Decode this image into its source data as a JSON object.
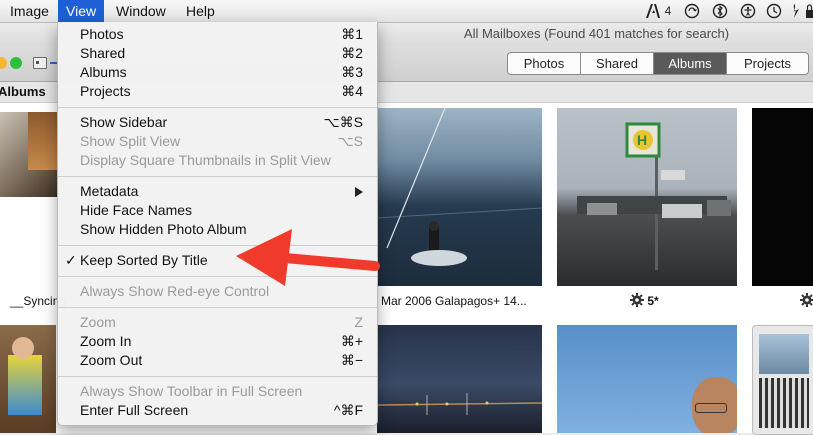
{
  "menubar": {
    "items": [
      "Image",
      "View",
      "Window",
      "Help"
    ],
    "adobe_count": "4"
  },
  "window": {
    "title": "All Mailboxes (Found 401 matches for search)"
  },
  "toolbar": {
    "tabs": [
      "Photos",
      "Shared",
      "Albums",
      "Projects"
    ],
    "active_tab": "Albums"
  },
  "content": {
    "section_label": "Albums",
    "captions": {
      "c1": "__Syncing",
      "c2": "Mar 2006 Galapagos+ 14...",
      "c3": "5*"
    }
  },
  "view_menu": {
    "photos": "Photos",
    "photos_sc": "⌘1",
    "shared": "Shared",
    "shared_sc": "⌘2",
    "albums": "Albums",
    "albums_sc": "⌘3",
    "projects": "Projects",
    "projects_sc": "⌘4",
    "show_sidebar": "Show Sidebar",
    "show_sidebar_sc": "⌥⌘S",
    "show_split": "Show Split View",
    "show_split_sc": "⌥S",
    "square_thumbs": "Display Square Thumbnails in Split View",
    "metadata": "Metadata",
    "hide_faces": "Hide Face Names",
    "show_hidden": "Show Hidden Photo Album",
    "keep_sorted": "Keep Sorted By Title",
    "check_mark": "✓",
    "redeye": "Always Show Red-eye Control",
    "zoom": "Zoom",
    "zoom_sc": "Z",
    "zoom_in": "Zoom In",
    "zoom_in_sc": "⌘+",
    "zoom_out": "Zoom Out",
    "zoom_out_sc": "⌘−",
    "toolbar_fs": "Always Show Toolbar in Full Screen",
    "enter_fs": "Enter Full Screen",
    "enter_fs_sc": "^⌘F"
  },
  "annotation": {
    "arrow_color": "#f03a2c"
  }
}
